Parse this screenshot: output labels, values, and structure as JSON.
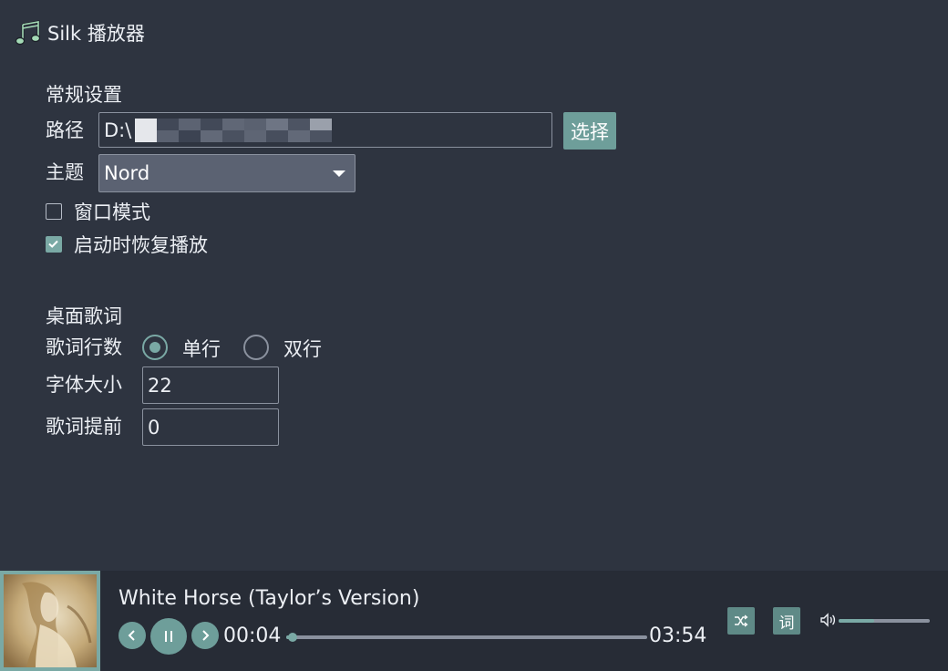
{
  "app": {
    "title": "Silk 播放器",
    "icon": "music-note-icon"
  },
  "general": {
    "section_title": "常规设置",
    "path_label": "路径",
    "path_value": "D:\\",
    "choose_label": "选择",
    "theme_label": "主题",
    "theme_value": "Nord",
    "window_mode_label": "窗口模式",
    "window_mode_checked": false,
    "resume_label": "启动时恢复播放",
    "resume_checked": true
  },
  "lyrics": {
    "section_title": "桌面歌词",
    "rows_label": "歌词行数",
    "single_label": "单行",
    "double_label": "双行",
    "selected": "单行",
    "font_size_label": "字体大小",
    "font_size_value": "22",
    "advance_label": "歌词提前",
    "advance_value": "0"
  },
  "player": {
    "song_title": "White Horse (Taylor’s Version)",
    "current_time": "00:04",
    "total_time": "03:54",
    "progress_fraction": 0.017,
    "volume_fraction": 0.39,
    "lyrics_button_label": "词",
    "shuffle_icon": "shuffle-icon",
    "volume_icon": "speaker-icon"
  },
  "colors": {
    "background": "#2e3440",
    "player_background": "#272c36",
    "accent": "#7aa9a5",
    "button": "#6e9e9a",
    "select_bg": "#5b6272"
  }
}
